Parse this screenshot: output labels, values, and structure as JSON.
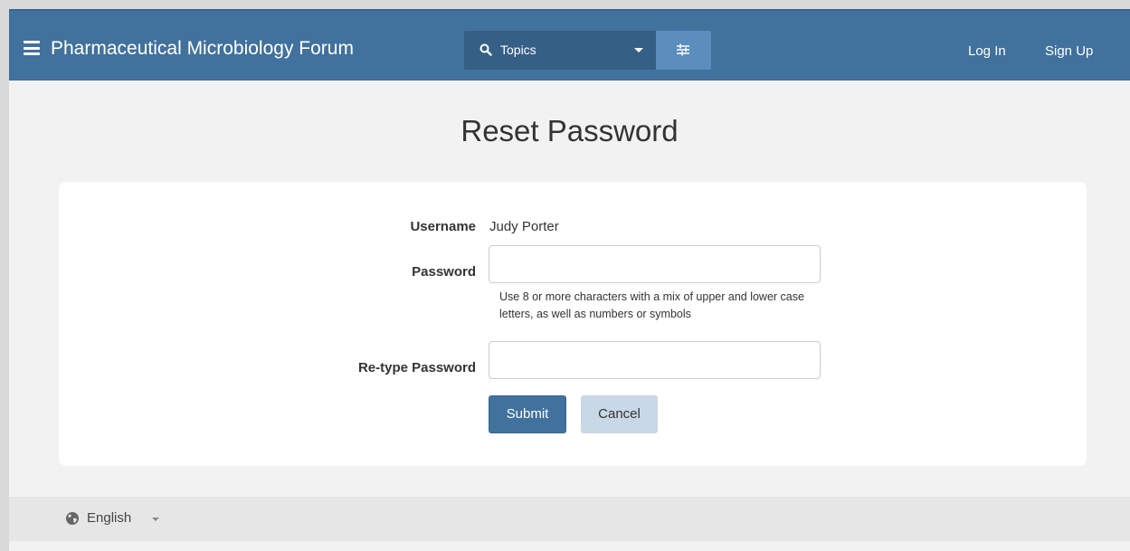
{
  "header": {
    "title": "Pharmaceutical Microbiology Forum",
    "search": {
      "label": "Topics",
      "icon": "search-icon"
    },
    "filter_icon": "sliders-icon",
    "login": "Log In",
    "signup": "Sign Up",
    "colors": {
      "navbar": "#41719d",
      "search_bg": "#365f85",
      "filter_bg": "#5b8dbd"
    }
  },
  "main": {
    "title": "Reset Password",
    "form": {
      "username_label": "Username",
      "username_value": "Judy Porter",
      "password_label": "Password",
      "password_value": "",
      "password_hint": "Use 8 or more characters with a mix of upper and lower case letters, as well as numbers or symbols",
      "retype_label": "Re-type Password",
      "retype_value": "",
      "submit": "Submit",
      "cancel": "Cancel"
    }
  },
  "footer": {
    "language": "English",
    "language_icon": "globe-icon"
  }
}
